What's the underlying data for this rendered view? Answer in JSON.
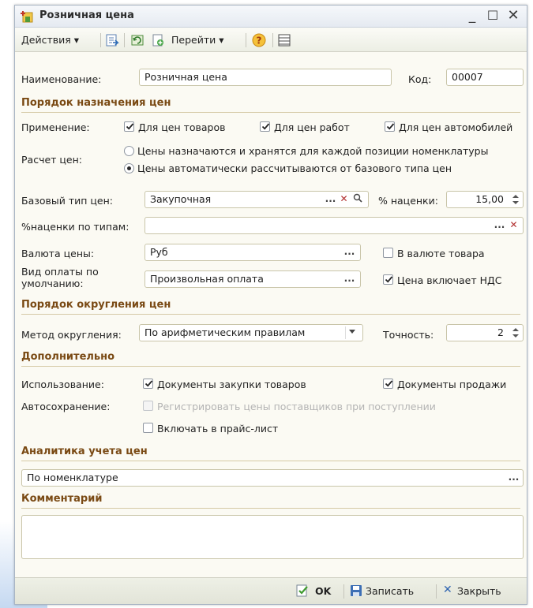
{
  "window": {
    "title": "Розничная цена"
  },
  "toolbar": {
    "actions_label": "Действия",
    "goto_label": "Перейти",
    "help_label": "?"
  },
  "name_row": {
    "label": "Наименование:",
    "value": "Розничная цена",
    "code_label": "Код:",
    "code_value": "00007"
  },
  "section_pricing": "Порядок назначения цен",
  "apply": {
    "label": "Применение:",
    "goods": "Для цен товаров",
    "works": "Для цен работ",
    "cars": "Для цен автомобилей",
    "goods_checked": true,
    "works_checked": true,
    "cars_checked": true
  },
  "calc": {
    "label": "Расчет цен:",
    "option_stored": "Цены назначаются и хранятся для каждой позиции номенклатуры",
    "option_auto": "Цены автоматически рассчитываются от базового типа цен",
    "selected": "option_auto"
  },
  "base_type": {
    "label": "Базовый тип цен:",
    "value": "Закупочная",
    "markup_label": "% наценки:",
    "markup_value": "15,00"
  },
  "markup_types": {
    "label": "%наценки по типам:",
    "value": ""
  },
  "currency": {
    "label": "Валюта цены:",
    "value": "Руб",
    "in_goods_currency": "В валюте товара",
    "in_goods_currency_checked": false
  },
  "payment": {
    "label_line1": "Вид оплаты по",
    "label_line2": "умолчанию:",
    "value": "Произвольная оплата",
    "vat_label": "Цена включает НДС",
    "vat_checked": true
  },
  "section_rounding": "Порядок округления цен",
  "rounding": {
    "method_label": "Метод округления:",
    "method_value": "По арифметическим правилам",
    "precision_label": "Точность:",
    "precision_value": "2"
  },
  "section_extra": "Дополнительно",
  "usage": {
    "label": "Использование:",
    "purchase_docs": "Документы закупки товаров",
    "sales_docs": "Документы продажи",
    "purchase_checked": true,
    "sales_checked": true
  },
  "autosave": {
    "label": "Автосохранение:",
    "register_prices": "Регистрировать цены поставщиков при поступлении",
    "register_enabled": false,
    "include_pricelist": "Включать в прайс-лист",
    "include_checked": false
  },
  "section_analytics": "Аналитика учета цен",
  "analytics": {
    "value": "По номенклатуре"
  },
  "section_comment": "Комментарий",
  "comment": {
    "value": ""
  },
  "footer": {
    "ok_label": "OK",
    "save_label": "Записать",
    "close_label": "Закрыть"
  }
}
